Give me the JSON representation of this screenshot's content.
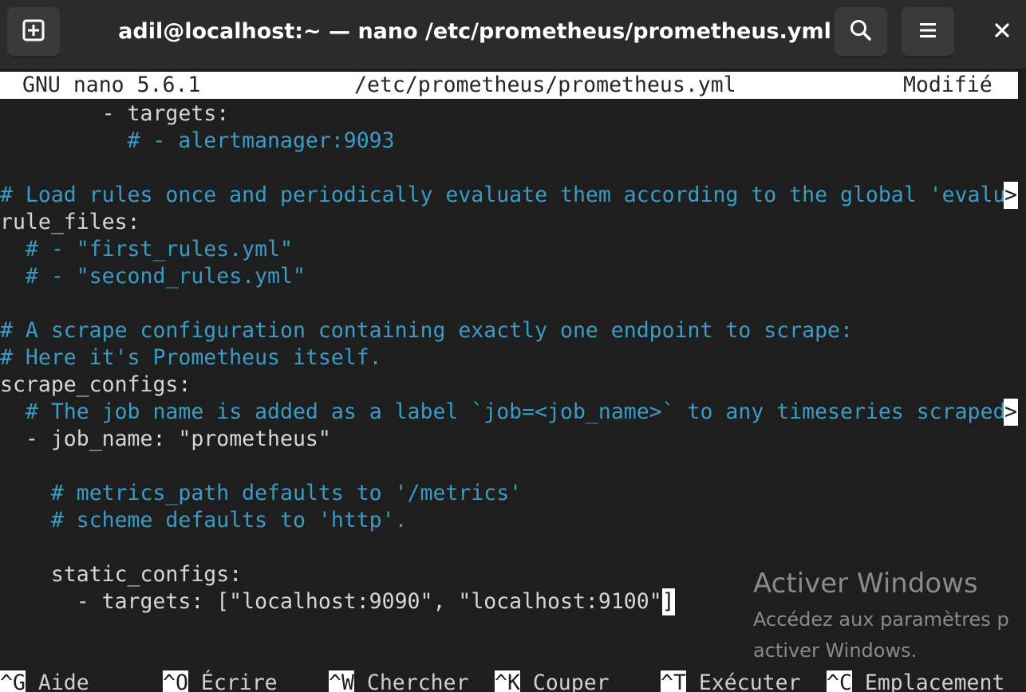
{
  "window": {
    "title": "adil@localhost:~ — nano /etc/prometheus/prometheus.yml",
    "new_tab_icon": "new-tab-icon",
    "search_icon": "search-icon",
    "menu_icon": "hamburger-menu-icon",
    "close_label": "×"
  },
  "nano": {
    "version": "GNU nano 5.6.1",
    "filename": "/etc/prometheus/prometheus.yml",
    "status": "Modifié"
  },
  "editor_lines": [
    {
      "indent": "        ",
      "comment": false,
      "text": "- targets:"
    },
    {
      "indent": "          ",
      "comment": true,
      "text": "# - alertmanager:9093"
    },
    {
      "indent": "",
      "comment": false,
      "text": ""
    },
    {
      "indent": "",
      "comment": true,
      "text": "# Load rules once and periodically evaluate them according to the global 'evalu",
      "truncated": true
    },
    {
      "indent": "",
      "comment": false,
      "text": "rule_files:"
    },
    {
      "indent": "  ",
      "comment": true,
      "text": "# - \"first_rules.yml\""
    },
    {
      "indent": "  ",
      "comment": true,
      "text": "# - \"second_rules.yml\""
    },
    {
      "indent": "",
      "comment": false,
      "text": ""
    },
    {
      "indent": "",
      "comment": true,
      "text": "# A scrape configuration containing exactly one endpoint to scrape:"
    },
    {
      "indent": "",
      "comment": true,
      "text": "# Here it's Prometheus itself."
    },
    {
      "indent": "",
      "comment": false,
      "text": "scrape_configs:"
    },
    {
      "indent": "  ",
      "comment": true,
      "text": "# The job name is added as a label `job=<job_name>` to any timeseries scraped",
      "truncated": true
    },
    {
      "indent": "  ",
      "comment": false,
      "text": "- job_name: \"prometheus\""
    },
    {
      "indent": "",
      "comment": false,
      "text": ""
    },
    {
      "indent": "    ",
      "comment": true,
      "text": "# metrics_path defaults to '/metrics'"
    },
    {
      "indent": "    ",
      "comment": true,
      "text": "# scheme defaults to 'http'."
    },
    {
      "indent": "",
      "comment": false,
      "text": ""
    },
    {
      "indent": "    ",
      "comment": false,
      "text": "static_configs:"
    },
    {
      "indent": "      ",
      "comment": false,
      "text": "- targets: [\"localhost:9090\", \"localhost:9100\"",
      "cursor": "]"
    }
  ],
  "truncation_marker": ">",
  "shortcuts": [
    {
      "key": "^G",
      "label": "Aide"
    },
    {
      "key": "^O",
      "label": "Écrire"
    },
    {
      "key": "^W",
      "label": "Chercher"
    },
    {
      "key": "^K",
      "label": "Couper"
    },
    {
      "key": "^T",
      "label": "Exécuter"
    },
    {
      "key": "^C",
      "label": "Emplacement"
    }
  ],
  "watermark": {
    "title": "Activer Windows",
    "line1": "Accédez aux paramètres p",
    "line2": "activer Windows."
  }
}
